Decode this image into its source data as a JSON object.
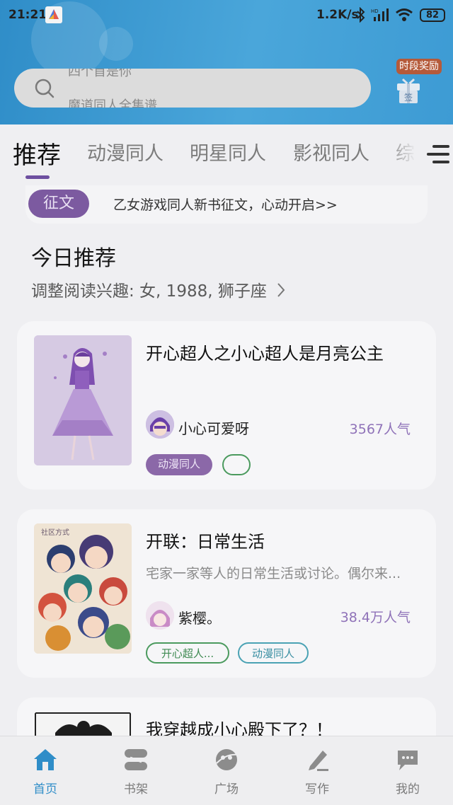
{
  "status_bar": {
    "time": "21:21",
    "network_speed": "1.2K/s",
    "battery": "82"
  },
  "search": {
    "line1": "四个首是你",
    "line2": "魔道同人全集谱"
  },
  "reward": {
    "label": "时段奖励",
    "gift_label": "签"
  },
  "tabs": [
    {
      "label": "推荐",
      "active": true
    },
    {
      "label": "动漫同人"
    },
    {
      "label": "明星同人"
    },
    {
      "label": "影视同人"
    },
    {
      "label": "综影"
    }
  ],
  "announcement": {
    "tag": "征文",
    "text": "乙女游戏同人新书征文，心动开启>>"
  },
  "today": {
    "title": "今日推荐",
    "subtitle": "调整阅读兴趣: 女, 1988, 狮子座"
  },
  "books": [
    {
      "title": "开心超人之小心超人是月亮公主",
      "description": "",
      "author": "小心可爱呀",
      "popularity": "3567人气",
      "tags": [
        "动漫同人",
        ""
      ]
    },
    {
      "title": "开联：日常生活",
      "description": "宅家一家等人的日常生活或讨论。偶尔来...",
      "author": "紫樱。",
      "popularity": "38.4万人气",
      "tags": [
        "开心超人...",
        "动漫同人"
      ]
    },
    {
      "title": "我穿越成小心殿下了？！",
      "description": "",
      "author": "",
      "popularity": "",
      "tags": []
    }
  ],
  "bottom_nav": [
    {
      "label": "首页",
      "icon": "home-icon",
      "active": true
    },
    {
      "label": "书架",
      "icon": "bookshelf-icon"
    },
    {
      "label": "广场",
      "icon": "plaza-icon"
    },
    {
      "label": "写作",
      "icon": "write-icon"
    },
    {
      "label": "我的",
      "icon": "profile-icon"
    }
  ],
  "colors": {
    "header_blue": "#3d9bd4",
    "accent_purple": "#6d4fa0",
    "popularity_purple": "#8f72b8",
    "nav_active": "#2f8dc8"
  }
}
